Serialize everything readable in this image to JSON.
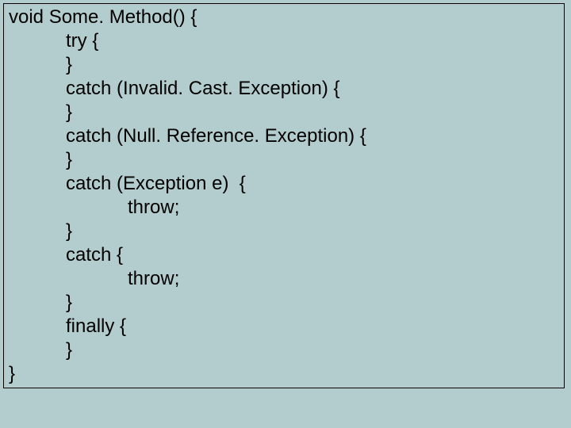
{
  "code": {
    "l01": "void Some. Method() {",
    "l02": "try {",
    "l03": "}",
    "l04": "catch (Invalid. Cast. Exception) {",
    "l05": "}",
    "l06": "catch (Null. Reference. Exception) {",
    "l07": "}",
    "l08": "catch (Exception e)  {",
    "l09": "throw;",
    "l10": "}",
    "l11": "catch {",
    "l12": "throw;",
    "l13": "}",
    "l14": "finally {",
    "l15": "}",
    "l16": "}"
  }
}
